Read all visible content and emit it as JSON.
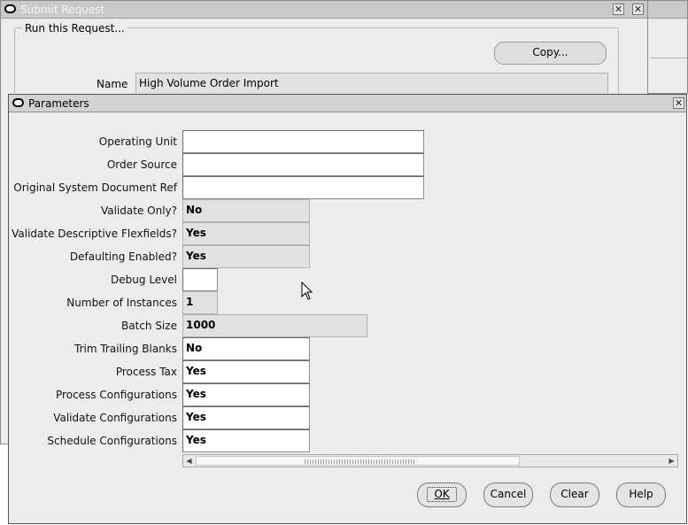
{
  "submit_window": {
    "title": "Submit Request",
    "group_label": "Run this Request...",
    "copy_button": "Copy...",
    "name_label": "Name",
    "name_value": "High Volume Order Import"
  },
  "parameters": {
    "title": "Parameters",
    "fields": [
      {
        "label": "Operating Unit",
        "value": ""
      },
      {
        "label": "Order Source",
        "value": ""
      },
      {
        "label": "Original System Document Ref",
        "value": ""
      },
      {
        "label": "Validate Only?",
        "value": "No"
      },
      {
        "label": "Validate Descriptive Flexfields?",
        "value": "Yes"
      },
      {
        "label": "Defaulting Enabled?",
        "value": "Yes"
      },
      {
        "label": "Debug Level",
        "value": ""
      },
      {
        "label": "Number of Instances",
        "value": "1"
      },
      {
        "label": "Batch Size",
        "value": "1000"
      },
      {
        "label": "Trim Trailing Blanks",
        "value": "No"
      },
      {
        "label": "Process Tax",
        "value": "Yes"
      },
      {
        "label": "Process Configurations",
        "value": "Yes"
      },
      {
        "label": "Validate Configurations",
        "value": "Yes"
      },
      {
        "label": "Schedule Configurations",
        "value": "Yes"
      }
    ],
    "buttons": {
      "ok": "OK",
      "cancel": "Cancel",
      "clear": "Clear",
      "help": "Help"
    }
  },
  "icons": {
    "minimize": "minimize-icon",
    "close": "close-icon",
    "window_logo": "oracle-logo-icon"
  }
}
